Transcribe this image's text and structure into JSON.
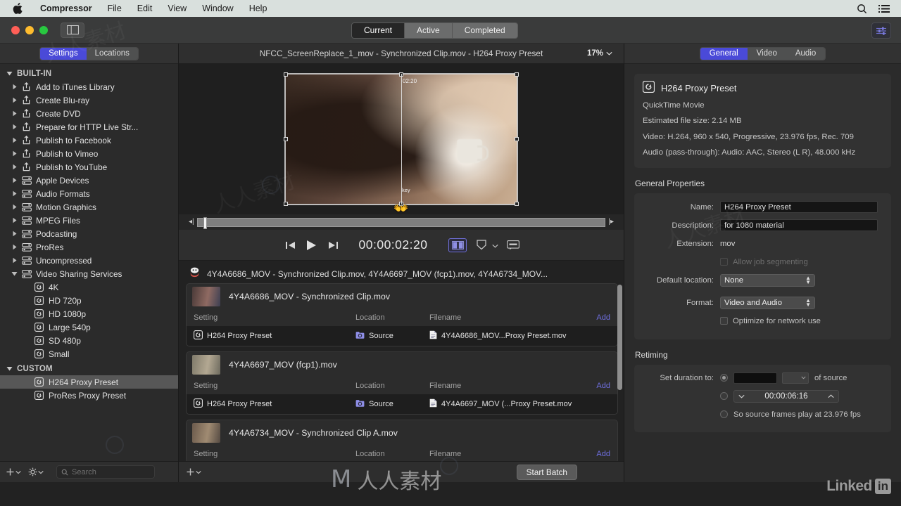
{
  "menubar": {
    "apple_icon": "apple-logo",
    "items": [
      "Compressor",
      "File",
      "Edit",
      "View",
      "Window",
      "Help"
    ],
    "right_icons": [
      "search-icon",
      "list-icon"
    ]
  },
  "toolbar": {
    "window_controls": [
      "close-button",
      "minimize-button",
      "zoom-button"
    ],
    "panel_toggle_icon": "sidebar-toggle-icon",
    "tabs": [
      {
        "label": "Current",
        "active": true
      },
      {
        "label": "Active",
        "active": false
      },
      {
        "label": "Completed",
        "active": false
      }
    ],
    "right_icon": "settings-sliders-icon"
  },
  "sidebar": {
    "tabs": [
      {
        "label": "Settings",
        "active": true
      },
      {
        "label": "Locations",
        "active": false
      }
    ],
    "groups": [
      {
        "label": "BUILT-IN",
        "expanded": true,
        "items": [
          {
            "label": "Add to iTunes Library",
            "icon": "share-icon",
            "disclosure": "collapsed",
            "indent": 1
          },
          {
            "label": "Create Blu-ray",
            "icon": "share-icon",
            "disclosure": "collapsed",
            "indent": 1
          },
          {
            "label": "Create DVD",
            "icon": "share-icon",
            "disclosure": "collapsed",
            "indent": 1
          },
          {
            "label": "Prepare for HTTP Live Str...",
            "icon": "share-icon",
            "disclosure": "collapsed",
            "indent": 1
          },
          {
            "label": "Publish to Facebook",
            "icon": "share-icon",
            "disclosure": "collapsed",
            "indent": 1
          },
          {
            "label": "Publish to Vimeo",
            "icon": "share-icon",
            "disclosure": "collapsed",
            "indent": 1
          },
          {
            "label": "Publish to YouTube",
            "icon": "share-icon",
            "disclosure": "collapsed",
            "indent": 1
          },
          {
            "label": "Apple Devices",
            "icon": "stack-icon",
            "disclosure": "collapsed",
            "indent": 1
          },
          {
            "label": "Audio Formats",
            "icon": "stack-icon",
            "disclosure": "collapsed",
            "indent": 1
          },
          {
            "label": "Motion Graphics",
            "icon": "stack-icon",
            "disclosure": "collapsed",
            "indent": 1
          },
          {
            "label": "MPEG Files",
            "icon": "stack-icon",
            "disclosure": "collapsed",
            "indent": 1
          },
          {
            "label": "Podcasting",
            "icon": "stack-icon",
            "disclosure": "collapsed",
            "indent": 1
          },
          {
            "label": "ProRes",
            "icon": "stack-icon",
            "disclosure": "collapsed",
            "indent": 1
          },
          {
            "label": "Uncompressed",
            "icon": "stack-icon",
            "disclosure": "collapsed",
            "indent": 1
          },
          {
            "label": "Video Sharing Services",
            "icon": "stack-icon",
            "disclosure": "expanded",
            "indent": 1
          },
          {
            "label": "4K",
            "icon": "preset-icon",
            "disclosure": "none",
            "indent": 2
          },
          {
            "label": "HD 720p",
            "icon": "preset-icon",
            "disclosure": "none",
            "indent": 2
          },
          {
            "label": "HD 1080p",
            "icon": "preset-icon",
            "disclosure": "none",
            "indent": 2
          },
          {
            "label": "Large 540p",
            "icon": "preset-icon",
            "disclosure": "none",
            "indent": 2
          },
          {
            "label": "SD 480p",
            "icon": "preset-icon",
            "disclosure": "none",
            "indent": 2
          },
          {
            "label": "Small",
            "icon": "preset-icon",
            "disclosure": "none",
            "indent": 2
          }
        ]
      },
      {
        "label": "CUSTOM",
        "expanded": true,
        "items": [
          {
            "label": "H264 Proxy Preset",
            "icon": "preset-icon",
            "disclosure": "none",
            "indent": 2,
            "selected": true
          },
          {
            "label": "ProRes Proxy Preset",
            "icon": "preset-icon",
            "disclosure": "none",
            "indent": 2,
            "selected": false
          }
        ]
      }
    ],
    "footer": {
      "add_label": "+",
      "add_icon": "plus-chevron-icon",
      "gear_icon": "gear-chevron-icon",
      "search_placeholder": "Search",
      "search_icon": "search-icon"
    }
  },
  "preview": {
    "title": "NFCC_ScreenReplace_1_mov - Synchronized Clip.mov - H264 Proxy Preset",
    "zoom_level": "17%",
    "zoom_chevron_icon": "chevron-down-icon",
    "overlay": {
      "timecode_label": "02:20",
      "key_label": "key",
      "cursor_icon": "open-hand-cursor"
    },
    "transport": {
      "prev_icon": "skip-back-icon",
      "play_icon": "play-icon",
      "next_icon": "skip-forward-icon",
      "timecode": "00:00:02:20",
      "split_view_icon": "split-view-icon",
      "marker_icon": "marker-shield-icon",
      "marker_chevron_icon": "chevron-down-icon",
      "caption_icon": "captions-icon"
    }
  },
  "batch": {
    "header_label": "4Y4A6686_MOV - Synchronized Clip.mov, 4Y4A6697_MOV (fcp1).mov, 4Y4A6734_MOV...",
    "header_icon": "batch-icon",
    "columns": [
      "Setting",
      "Location",
      "Filename"
    ],
    "add_label": "Add",
    "jobs": [
      {
        "title": "4Y4A6686_MOV - Synchronized Clip.mov",
        "thumb_colors": [
          "#4a3a38",
          "#8f6a62",
          "#3d3f52"
        ],
        "setting": "H264 Proxy Preset",
        "setting_icon": "preset-icon",
        "location": "Source",
        "location_icon": "folder-icon",
        "filename": "4Y4A6686_MOV...Proxy Preset.mov",
        "filename_icon": "file-icon"
      },
      {
        "title": "4Y4A6697_MOV (fcp1).mov",
        "thumb_colors": [
          "#7f7a6a",
          "#b3a892",
          "#6d6a5e"
        ],
        "setting": "H264 Proxy Preset",
        "setting_icon": "preset-icon",
        "location": "Source",
        "location_icon": "folder-icon",
        "filename": "4Y4A6697_MOV (...Proxy Preset.mov",
        "filename_icon": "file-icon"
      },
      {
        "title": "4Y4A6734_MOV - Synchronized Clip A.mov",
        "thumb_colors": [
          "#6b5a4c",
          "#a08b72",
          "#554a42"
        ],
        "setting": "",
        "setting_icon": "preset-icon",
        "location": "",
        "location_icon": "folder-icon",
        "filename": "",
        "filename_icon": "file-icon"
      }
    ],
    "footer": {
      "add_icon": "plus-chevron-icon",
      "start_batch_label": "Start Batch"
    }
  },
  "inspector": {
    "tabs": [
      {
        "label": "General",
        "active": true
      },
      {
        "label": "Video",
        "active": false
      },
      {
        "label": "Audio",
        "active": false
      }
    ],
    "summary": {
      "icon": "preset-icon",
      "title": "H264 Proxy Preset",
      "lines": [
        "QuickTime Movie",
        "Estimated file size: 2.14 MB",
        "Video: H.264, 960 x 540, Progressive, 23.976 fps, Rec. 709",
        "Audio (pass-through): Audio: AAC, Stereo (L R), 48.000 kHz"
      ]
    },
    "general_properties": {
      "section_label": "General Properties",
      "name_label": "Name:",
      "name_value": "H264 Proxy Preset",
      "description_label": "Description:",
      "description_value": "for 1080 material",
      "extension_label": "Extension:",
      "extension_value": "mov",
      "allow_segmenting_label": "Allow job segmenting",
      "allow_segmenting_checked": false,
      "default_location_label": "Default location:",
      "default_location_value": "None",
      "format_label": "Format:",
      "format_value": "Video and Audio",
      "optimize_label": "Optimize for network use",
      "optimize_checked": false
    },
    "retiming": {
      "section_label": "Retiming",
      "set_duration_label": "Set duration to:",
      "percent_value": "",
      "percent_unit": "",
      "of_source_label": "of source",
      "duration_value": "00:00:06:16",
      "frames_label": "So source frames play at 23.976 fps",
      "selected_option": 0,
      "decrement_icon": "chevron-down-icon",
      "increment_icon": "chevron-up-icon"
    }
  },
  "watermarks": {
    "center_mark": "M",
    "center_text": "人人素材",
    "linkedin_word": "Linked",
    "linkedin_badge": "in"
  },
  "colors": {
    "accent_blue": "#4a4ad8",
    "link_blue": "#6f6fe0",
    "toolbar_bg": "#3a3b3b",
    "sidebar_bg": "#2b2b2b",
    "panel_bg": "#323232",
    "selection_gray": "#575757"
  }
}
